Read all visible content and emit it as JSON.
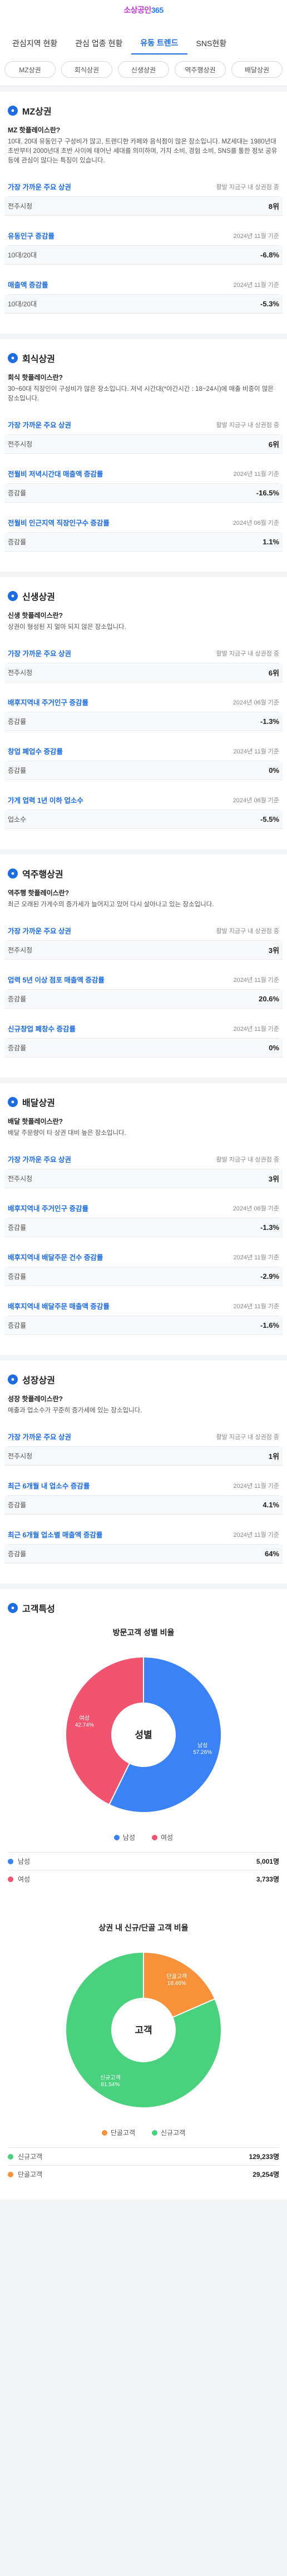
{
  "header": {
    "logo_prefix": "소상공인",
    "logo_num": "365"
  },
  "main_tabs": [
    "관심지역 현황",
    "관심 업종 현황",
    "유동 트렌드",
    "SNS현황"
  ],
  "sub_tabs": [
    "MZ상권",
    "회식상권",
    "신생상권",
    "역주행상권",
    "배달상권"
  ],
  "sections": [
    {
      "title": "MZ상권",
      "question": "MZ 핫플레이스란?",
      "desc": "10대, 20대 유동인구 구성비가 많고, 트렌디한 카페와 음식점이 많은 장소입니다. MZ세대는 1980년대 초반부터 2000년대 초반 사이에 태어난 세대를 의미하며, 가치 소비, 경험 소비, SNS를 통한 정보 공유 등에 관심이 많다는 특징이 있습니다.",
      "rows": [
        {
          "label": "가장 가까운 주요 상권",
          "note": "활발 지금구 내 상권점 중",
          "sub": "전주시청",
          "value": "8위"
        },
        {
          "label": "유동인구 증감률",
          "note": "2024년 11월 기준",
          "sub": "10대/20대",
          "value": "-6.8%"
        },
        {
          "label": "매출액 증감률",
          "note": "2024년 11월 기준",
          "sub": "10대/20대",
          "value": "-5.3%"
        }
      ]
    },
    {
      "title": "회식상권",
      "question": "회식 핫플레이스란?",
      "desc": "30~60대 직장인이 구성비가 많은 장소입니다. 저녁 시간대(*야간시간 : 18~24시)에 매출 비중이 많은 장소입니다.",
      "rows": [
        {
          "label": "가장 가까운 주요 상권",
          "note": "활발 지금구 내 상권점 중",
          "sub": "전주시청",
          "value": "6위"
        },
        {
          "label": "전월비 저녁시간대 매출액 증감률",
          "note": "2024년 11월 기준",
          "sub": "증감률",
          "value": "-16.5%"
        },
        {
          "label": "전월비 인근지역 직장인구수 증감률",
          "note": "2024년 06월 기준",
          "sub": "증감률",
          "value": "1.1%"
        }
      ]
    },
    {
      "title": "신생상권",
      "question": "신생 핫플레이스란?",
      "desc": "상권이 형성된 지 얼마 되지 않은 장소입니다.",
      "rows": [
        {
          "label": "가장 가까운 주요 상권",
          "note": "활발 지금구 내 상권점 중",
          "sub": "전주시청",
          "value": "6위"
        },
        {
          "label": "배후지역내 주거인구 증감률",
          "note": "2024년 06월 기준",
          "sub": "증감률",
          "value": "-1.3%"
        },
        {
          "label": "창업 폐업수 증감률",
          "note": "2024년 11월 기준",
          "sub": "증감률",
          "value": "0%"
        },
        {
          "label": "가게 업력 1년 이하 업소수",
          "note": "2024년 06월 기준",
          "sub": "업소수",
          "value": "-5.5%"
        }
      ]
    },
    {
      "title": "역주행상권",
      "question": "역주행 핫플레이스란?",
      "desc": "최근 오래된 가게수의 증가세가 늘어지고 있어 다시 살아나고 있는 장소입니다.",
      "rows": [
        {
          "label": "가장 가까운 주요 상권",
          "note": "활발 지금구 내 상권점 중",
          "sub": "전주시청",
          "value": "3위"
        },
        {
          "label": "업력 5년 이상 점포 매출액 증감률",
          "note": "2024년 11월 기준",
          "sub": "증감률",
          "value": "20.6%"
        },
        {
          "label": "신규창업 폐창수 증감률",
          "note": "2024년 11월 기준",
          "sub": "증감률",
          "value": "0%"
        }
      ]
    },
    {
      "title": "배달상권",
      "question": "배달 핫플레이스란?",
      "desc": "배달 주문량이 타 상권 대비 높은 장소입니다.",
      "rows": [
        {
          "label": "가장 가까운 주요 상권",
          "note": "활발 지금구 내 상권점 중",
          "sub": "전주시청",
          "value": "3위"
        },
        {
          "label": "배후지역내 주거인구 증감률",
          "note": "2024년 06월 기준",
          "sub": "증감률",
          "value": "-1.3%"
        },
        {
          "label": "배후지역내 배달주문 건수 증감률",
          "note": "2024년 11월 기준",
          "sub": "증감률",
          "value": "-2.9%"
        },
        {
          "label": "배후지역내 배달주문 매출액 증감률",
          "note": "2024년 11월 기준",
          "sub": "증감률",
          "value": "-1.6%"
        }
      ]
    },
    {
      "title": "성장상권",
      "question": "성장 핫플레이스란?",
      "desc": "매출과 업소수가 꾸준히 증가세에 있는 장소입니다.",
      "rows": [
        {
          "label": "가장 가까운 주요 상권",
          "note": "활발 지금구 내 상권점 중",
          "sub": "전주시청",
          "value": "1위"
        },
        {
          "label": "최근 6개월 내 업소수 증감률",
          "note": "2024년 11월 기준",
          "sub": "증감률",
          "value": "4.1%"
        },
        {
          "label": "최근 6개월 업소별 매출액 증감률",
          "note": "2024년 11월 기준",
          "sub": "증감률",
          "value": "64%"
        }
      ]
    }
  ],
  "customer": {
    "title": "고객특성",
    "gender_chart_title": "방문고객 성별 비율",
    "gender_center": "성별",
    "cust_chart_title": "상권 내 신규/단골 고객 비율",
    "cust_center": "고객",
    "gender_rows": [
      {
        "name": "남성",
        "value": "5,001명"
      },
      {
        "name": "여성",
        "value": "3,733명"
      }
    ],
    "cust_rows": [
      {
        "name": "신규고객",
        "value": "129,233명"
      },
      {
        "name": "단골고객",
        "value": "29,254명"
      }
    ]
  },
  "chart_data": [
    {
      "type": "pie",
      "title": "방문고객 성별 비율",
      "categories": [
        "남성",
        "여성"
      ],
      "values": [
        57.26,
        42.74
      ],
      "colors": [
        "#3b82f6",
        "#f2546f"
      ]
    },
    {
      "type": "pie",
      "title": "상권 내 신규/단골 고객 비율",
      "categories": [
        "단골고객",
        "신규고객"
      ],
      "values": [
        18.46,
        81.54
      ],
      "colors": [
        "#f7923b",
        "#4ad17d"
      ]
    }
  ]
}
